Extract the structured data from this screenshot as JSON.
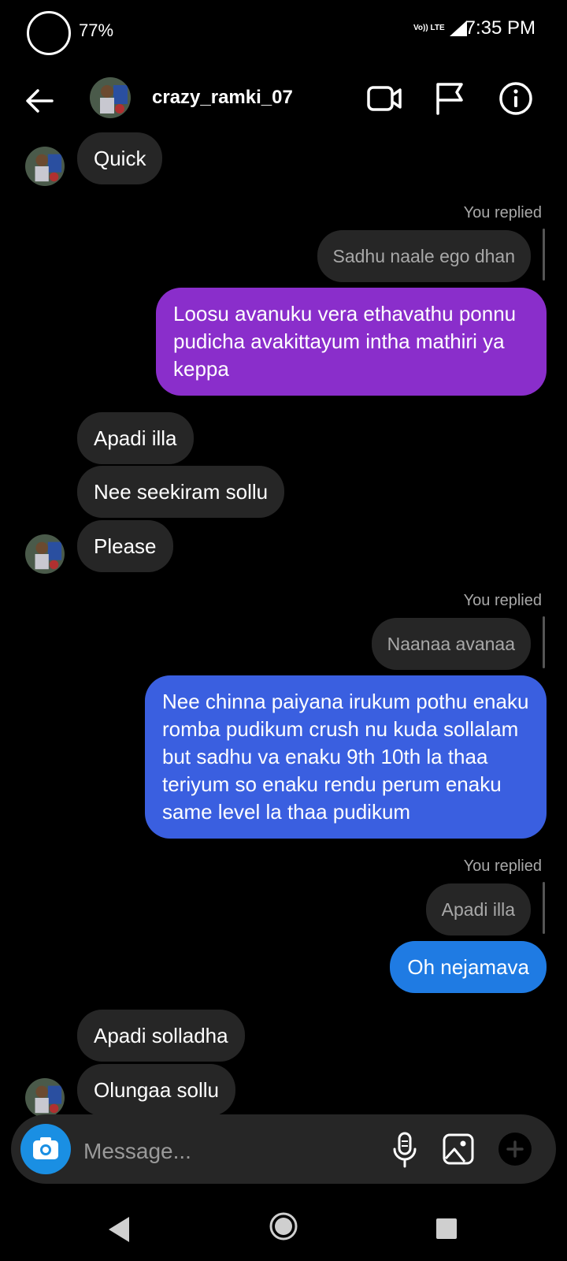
{
  "status_bar": {
    "battery_percent": "77%",
    "network": "Vo)) LTE",
    "network_line2": "LTE",
    "time": "7:35 PM"
  },
  "header": {
    "username": "crazy_ramki_07",
    "icons": [
      "back-arrow-icon",
      "video-call-icon",
      "flag-icon",
      "info-icon"
    ]
  },
  "messages": {
    "m1": "Quick",
    "r1_label": "You replied",
    "r1_quote": "Sadhu naale ego dhan",
    "out1": "Loosu avanuku vera ethavathu ponnu pudicha avakittayum intha mathiri ya keppa",
    "m2": "Apadi illa",
    "m3": "Nee seekiram sollu",
    "m4": "Please",
    "r2_label": "You replied",
    "r2_quote": "Naanaa avanaa",
    "out2": "Nee chinna paiyana irukum pothu enaku romba pudikum crush nu kuda sollalam but sadhu va enaku 9th 10th la thaa teriyum so enaku rendu perum enaku same level la thaa pudikum",
    "r3_label": "You replied",
    "r3_quote": "Apadi illa",
    "out3": "Oh nejamava",
    "m5": "Apadi solladha",
    "m6": "Olungaa sollu"
  },
  "colors": {
    "out1_bubble": "#8a2ecb",
    "out2_bubble": "#3a5fe0",
    "out3_bubble": "#1f7be3",
    "camera_button": "#1a8fe3"
  },
  "composer": {
    "placeholder": "Message...",
    "icons": [
      "camera-icon",
      "microphone-icon",
      "gallery-icon",
      "add-icon"
    ]
  }
}
